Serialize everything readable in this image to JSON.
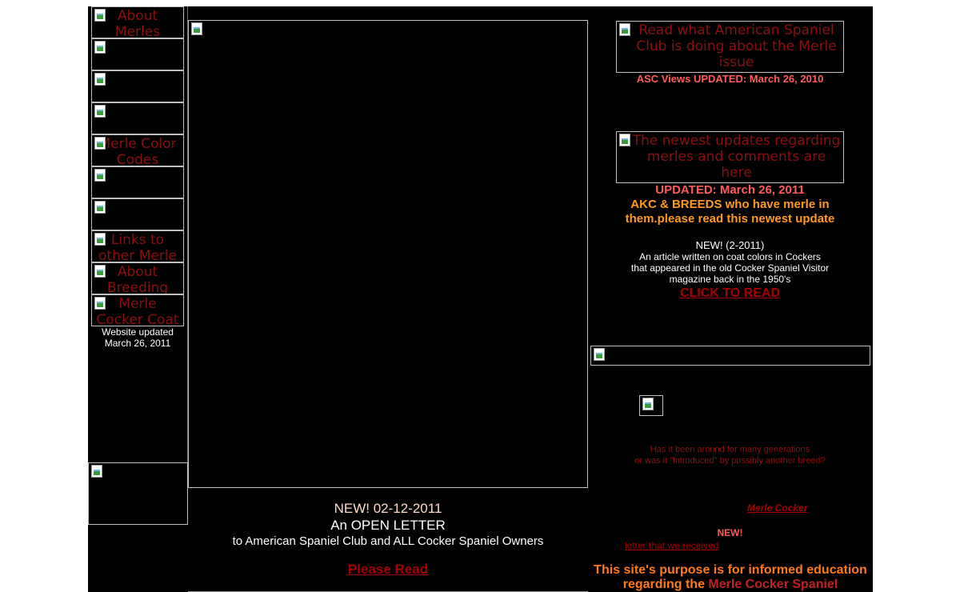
{
  "sidebar": {
    "nav": [
      {
        "label": "About Merles"
      },
      {
        "label": ""
      },
      {
        "label": ""
      },
      {
        "label": ""
      },
      {
        "label": "Merle Color Codes"
      },
      {
        "label": ""
      },
      {
        "label": ""
      },
      {
        "label": "Links to other Merle"
      },
      {
        "label": "About Breeding"
      },
      {
        "label": "Merle Cocker Coat"
      }
    ],
    "updated_line1": "Website updated",
    "updated_line2": "March 26, 2011"
  },
  "center": {
    "new_date": "NEW! 02-12-2011",
    "open_letter": "An OPEN LETTER",
    "letter_to": "to American Spaniel Club and ALL Cocker Spaniel Owners",
    "please_read": "Please Read"
  },
  "right": {
    "asc_image_alt": "Read what American Spaniel Club is doing about the Merle issue",
    "asc_views": "ASC Views UPDATED: March 26, 2010",
    "updates_image_alt": "The newest updates regarding merles and comments are here",
    "updated_date": "UPDATED: March 26, 2011",
    "akc_line1": "AKC & BREEDS who have merle in",
    "akc_line2": "them.please read this newest update",
    "new_article": "NEW! (2-2011)",
    "article_line1": "An article written on coat colors in Cockers",
    "article_line2": "that appeared in the old Cocker Spaniel Visitor",
    "article_line3": "magazine back in the 1950's",
    "click_to_read": "CLICK TO READ",
    "question_line1": "Has it been around for many generations",
    "question_line2": "or was it \"introduced\" by possibly another breed?",
    "merle_cocker_link": "Merle Cocker",
    "new_label": "NEW!",
    "letter_link": "letter that we received",
    "purpose_line1": "This site's purpose is for informed education",
    "purpose_line2_prefix": "regarding the ",
    "purpose_line2_highlight": "Merle Cocker Spaniel"
  },
  "colors": {
    "background": "#000000",
    "link": "#a40000",
    "heading_red": "#ff5b5b",
    "heading_orange": "#ff9a1f"
  }
}
